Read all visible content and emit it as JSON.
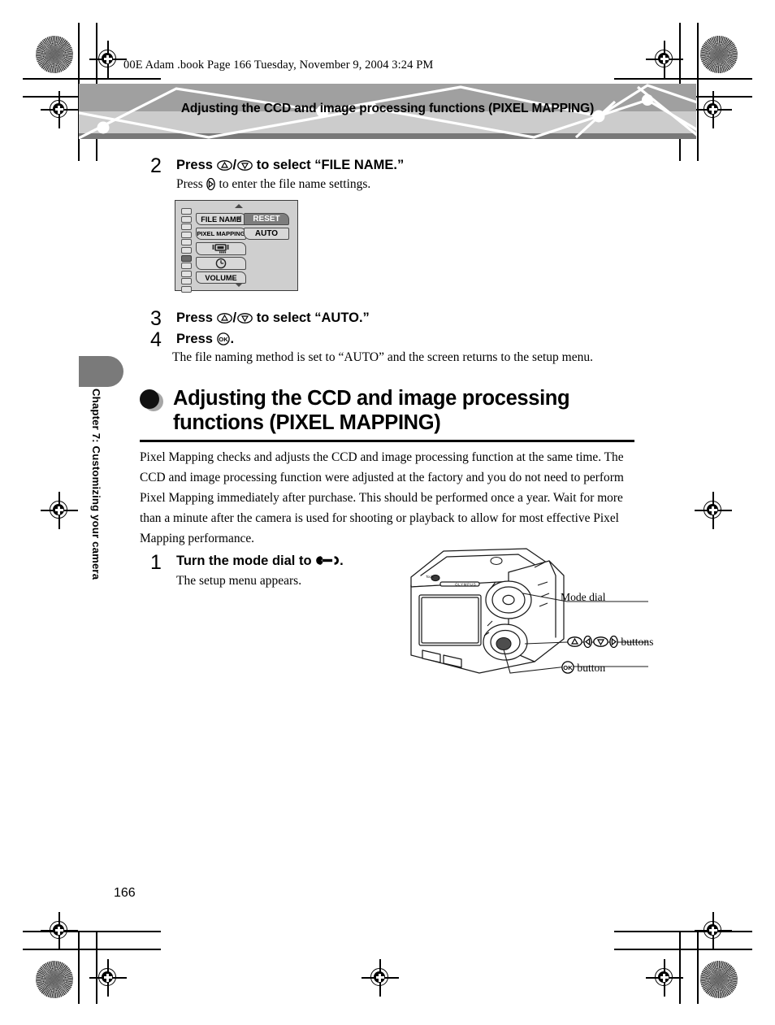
{
  "page": {
    "running_head": "00E Adam .book  Page 166  Tuesday, November 9, 2004  3:24 PM",
    "banner_title": "Adjusting the CCD and image processing functions (PIXEL MAPPING)",
    "chapter_tab": "Chapter 7: Customizing your camera",
    "page_number": "166",
    "colors": {
      "banner_top": "#a0a0a0",
      "banner_bottom": "#cccccc",
      "banner_rule": "#787878",
      "chapter_tab": "#7a7a7a",
      "lcd_background": "#cfcfcf",
      "lcd_selected": "#7d7d7d",
      "text": "#000000"
    }
  },
  "steps": [
    {
      "number": "2",
      "heading_before": "Press ",
      "heading_icons": "up-arrow-button / down-arrow-button",
      "heading_after": " to select “FILE NAME.”",
      "body_before": "Press ",
      "body_icon": "right-arrow-button",
      "body_after": " to enter the file name settings."
    },
    {
      "number": "3",
      "heading_before": "Press ",
      "heading_icons": "up-arrow-button / down-arrow-button",
      "heading_after": " to select “AUTO.”"
    },
    {
      "number": "4",
      "heading_before": "Press ",
      "heading_icons": "ok-button",
      "heading_after": ".",
      "body": "The file naming method is set to “AUTO” and the screen returns to the setup menu."
    }
  ],
  "lcd_menu": {
    "left_items": [
      {
        "label": "FILE NAME",
        "selected": false
      },
      {
        "label": "PIXEL MAPPING",
        "selected": false
      },
      {
        "label": "",
        "icon": "monitor-brightness-icon",
        "selected": false
      },
      {
        "label": "",
        "icon": "clock-icon",
        "selected": false
      },
      {
        "label": "VOLUME",
        "selected": false
      }
    ],
    "right_items": [
      {
        "label": "RESET",
        "selected": true
      },
      {
        "label": "AUTO",
        "selected": false
      }
    ],
    "scroll_segments": 11,
    "scroll_active_index": 6,
    "up_arrow": "scroll-up-arrow",
    "down_arrow": "scroll-down-arrow"
  },
  "section": {
    "bullet": "filled-circle-bullet",
    "title": "Adjusting the CCD and image processing functions (PIXEL MAPPING)",
    "paragraph": "Pixel Mapping checks and adjusts the CCD and image processing function at the same time. The CCD and image processing function were adjusted at the factory and you do not need to perform Pixel Mapping immediately after purchase. This should be performed once a year. Wait for more than a minute after the camera is used for shooting or playback to allow for most effective Pixel Mapping performance."
  },
  "step_one": {
    "number": "1",
    "heading_before": "Turn the mode dial to ",
    "heading_icon": "wrench-setup-icon",
    "heading_after": ".",
    "body": "The setup menu appears."
  },
  "camera_figure": {
    "brand_text": "OLYMPUS",
    "callouts": [
      {
        "label": "Mode dial",
        "icon": ""
      },
      {
        "label": " buttons",
        "icon": "arrow-pad-buttons"
      },
      {
        "label": " button",
        "icon": "ok-button"
      }
    ]
  }
}
